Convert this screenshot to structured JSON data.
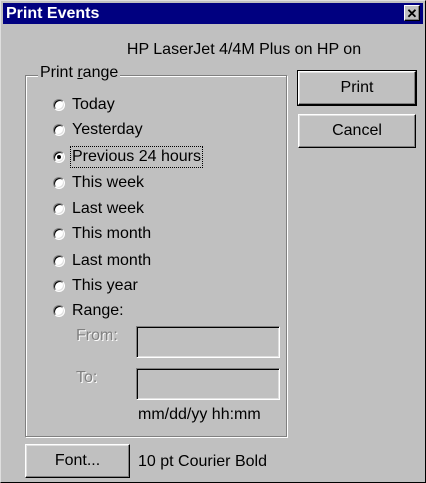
{
  "window": {
    "title": "Print Events",
    "close_label": "✕"
  },
  "printer_name": "HP LaserJet 4/4M Plus on HP on",
  "print_range": {
    "legend_prefix": "Print ",
    "legend_accel": "r",
    "legend_suffix": "ange",
    "options": [
      {
        "label": "Today",
        "checked": false
      },
      {
        "label": "Yesterday",
        "checked": false
      },
      {
        "label": "Previous 24 hours",
        "checked": true
      },
      {
        "label": "This week",
        "checked": false
      },
      {
        "label": "Last week",
        "checked": false
      },
      {
        "label": "This month",
        "checked": false
      },
      {
        "label": "Last month",
        "checked": false
      },
      {
        "label": "This year",
        "checked": false
      },
      {
        "label": "Range:",
        "checked": false
      }
    ],
    "from_label": "From:",
    "from_value": "",
    "to_label": "To:",
    "to_value": "",
    "format_hint": "mm/dd/yy hh:mm"
  },
  "buttons": {
    "print": "Print",
    "cancel": "Cancel",
    "font": "Font..."
  },
  "font_value": "10 pt Courier Bold"
}
